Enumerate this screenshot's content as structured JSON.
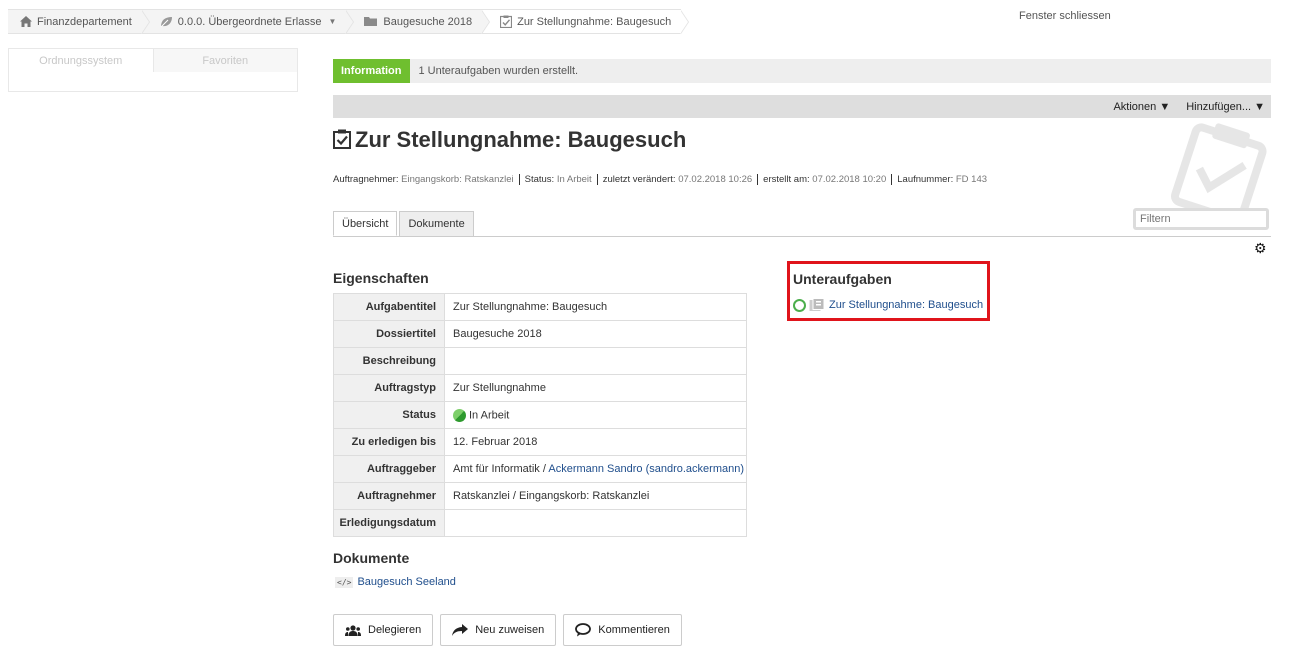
{
  "breadcrumb": [
    {
      "label": "Finanzdepartement",
      "icon": "home-icon"
    },
    {
      "label": "0.0.0. Übergeordnete Erlasse",
      "icon": "leaf-icon"
    },
    {
      "label": "Baugesuche 2018",
      "icon": "folder-icon"
    },
    {
      "label": "Zur Stellungnahme: Baugesuch",
      "icon": "task-icon"
    }
  ],
  "window": {
    "close_label": "Fenster schliessen"
  },
  "left_panel": {
    "tabs": [
      "Ordnungssystem",
      "Favoriten"
    ]
  },
  "info": {
    "badge": "Information",
    "message": "1 Unteraufgaben wurden erstellt."
  },
  "toolbar": {
    "actions_label": "Aktionen ▼",
    "add_label": "Hinzufügen... ▼"
  },
  "page_title": "Zur Stellungnahme: Baugesuch",
  "meta": [
    {
      "label": "Auftragnehmer: ",
      "value": "Eingangskorb: Ratskanzlei"
    },
    {
      "label": "Status: ",
      "value": "In Arbeit"
    },
    {
      "label": "zuletzt verändert: ",
      "value": "07.02.2018 10:26"
    },
    {
      "label": "erstellt am: ",
      "value": "07.02.2018 10:20"
    },
    {
      "label": "Laufnummer: ",
      "value": "FD 143"
    }
  ],
  "tabs": [
    "Übersicht",
    "Dokumente"
  ],
  "filter": {
    "placeholder": "Filtern"
  },
  "properties": {
    "heading": "Eigenschaften",
    "rows": [
      {
        "key": "Aufgabentitel",
        "value": "Zur Stellungnahme: Baugesuch"
      },
      {
        "key": "Dossiertitel",
        "value": "Baugesuche 2018"
      },
      {
        "key": "Beschreibung",
        "value": ""
      },
      {
        "key": "Auftragstyp",
        "value": "Zur Stellungnahme"
      },
      {
        "key": "Status",
        "value": "In Arbeit"
      },
      {
        "key": "Zu erledigen bis",
        "value": "12. Februar 2018"
      },
      {
        "key": "Auftraggeber",
        "value": "Amt für Informatik / ",
        "link": "Ackermann Sandro (sandro.ackermann)"
      },
      {
        "key": "Auftragnehmer",
        "value": "Ratskanzlei / Eingangskorb: Ratskanzlei"
      },
      {
        "key": "Erledigungsdatum",
        "value": ""
      }
    ]
  },
  "subtasks": {
    "heading": "Unteraufgaben",
    "items": [
      "Zur Stellungnahme: Baugesuch"
    ]
  },
  "documents": {
    "heading": "Dokumente",
    "items": [
      "Baugesuch Seeland"
    ]
  },
  "buttons": {
    "delegate": "Delegieren",
    "reassign": "Neu zuweisen",
    "comment": "Kommentieren"
  }
}
